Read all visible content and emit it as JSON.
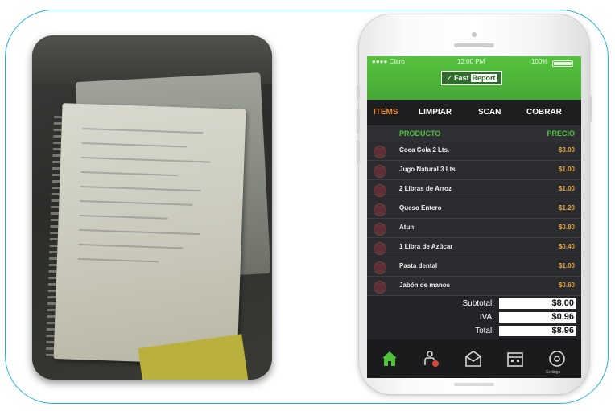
{
  "app": {
    "logo": {
      "check": "✓",
      "word1": "Fast",
      "word2": "Report"
    },
    "status": {
      "carrier": "●●●● Claro",
      "time": "12:00 PM",
      "battery": "100%"
    },
    "tabs": [
      {
        "label": "ITEMS",
        "active": true
      },
      {
        "label": "LIMPIAR",
        "active": false
      },
      {
        "label": "SCAN",
        "active": false
      },
      {
        "label": "COBRAR",
        "active": false
      }
    ],
    "columns": {
      "product": "PRODUCTO",
      "price": "PRECIO"
    },
    "items": [
      {
        "name": "Coca Cola 2 Lts.",
        "price": "$3.00"
      },
      {
        "name": "Jugo Natural 3 Lts.",
        "price": "$1.00"
      },
      {
        "name": "2 Libras de Arroz",
        "price": "$1.00"
      },
      {
        "name": "Queso Entero",
        "price": "$1.20"
      },
      {
        "name": "Atun",
        "price": "$0.80"
      },
      {
        "name": "1 Libra de Azúcar",
        "price": "$0.40"
      },
      {
        "name": "Pasta dental",
        "price": "$1.00"
      },
      {
        "name": "Jabón de manos",
        "price": "$0.60"
      }
    ],
    "totals": {
      "subtotal_label": "Subtotal:",
      "subtotal": "$8.00",
      "iva_label": "IVA:",
      "iva": "$0.96",
      "total_label": "Total:",
      "total": "$8.96"
    },
    "nav": {
      "items": [
        {
          "icon": "home-icon",
          "active": true
        },
        {
          "icon": "add-user-icon",
          "active": false
        },
        {
          "icon": "envelope-icon",
          "active": false
        },
        {
          "icon": "calendar-icon",
          "active": false
        },
        {
          "icon": "settings-icon",
          "active": false
        }
      ],
      "settings_label": "Settings"
    },
    "colors": {
      "accent_green": "#4fc13b",
      "tab_active": "#e98a38",
      "price": "#e5a63a",
      "frame": "#20b4e6"
    }
  }
}
